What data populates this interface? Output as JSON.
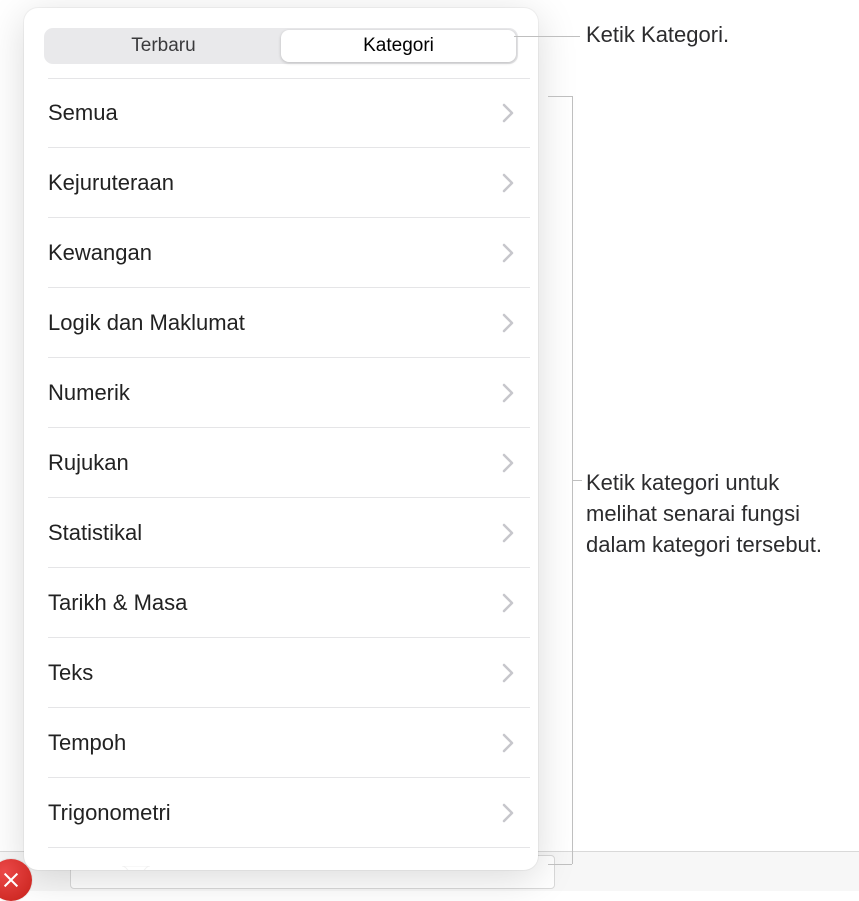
{
  "segmented": {
    "recent": "Terbaru",
    "category": "Kategori"
  },
  "categories": [
    {
      "label": "Semua"
    },
    {
      "label": "Kejuruteraan"
    },
    {
      "label": "Kewangan"
    },
    {
      "label": "Logik dan Maklumat"
    },
    {
      "label": "Numerik"
    },
    {
      "label": "Rujukan"
    },
    {
      "label": "Statistikal"
    },
    {
      "label": "Tarikh & Masa"
    },
    {
      "label": "Teks"
    },
    {
      "label": "Tempoh"
    },
    {
      "label": "Trigonometri"
    }
  ],
  "callouts": {
    "tap_category": "Ketik Kategori.",
    "tap_list": "Ketik kategori untuk melihat senarai fungsi dalam kategori tersebut."
  },
  "colors": {
    "chevron": "#c7c7cc"
  }
}
